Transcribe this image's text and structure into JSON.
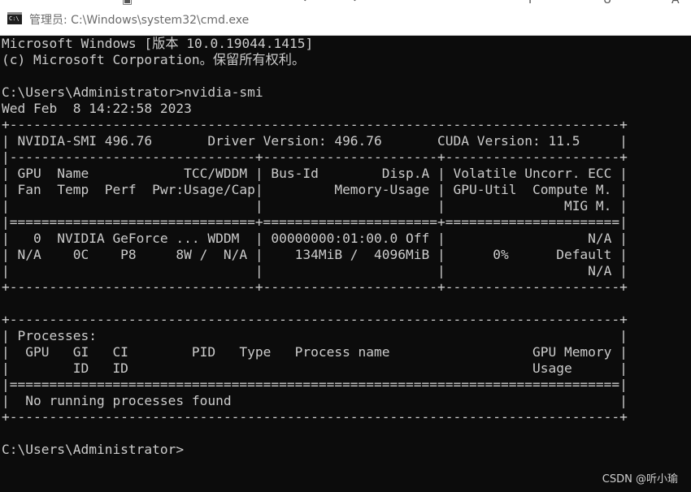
{
  "window": {
    "title": "管理员: C:\\Windows\\system32\\cmd.exe",
    "icon": "cmd-icon"
  },
  "console": {
    "lines": [
      "Microsoft Windows [版本 10.0.19044.1415]",
      "(c) Microsoft Corporation。保留所有权利。",
      "",
      "C:\\Users\\Administrator>nvidia-smi",
      "Wed Feb  8 14:22:58 2023",
      "+-----------------------------------------------------------------------------+",
      "| NVIDIA-SMI 496.76       Driver Version: 496.76       CUDA Version: 11.5     |",
      "|-------------------------------+----------------------+----------------------+",
      "| GPU  Name            TCC/WDDM | Bus-Id        Disp.A | Volatile Uncorr. ECC |",
      "| Fan  Temp  Perf  Pwr:Usage/Cap|         Memory-Usage | GPU-Util  Compute M. |",
      "|                               |                      |               MIG M. |",
      "|===============================+======================+======================|",
      "|   0  NVIDIA GeForce ... WDDM  | 00000000:01:00.0 Off |                  N/A |",
      "| N/A    0C    P8     8W /  N/A |    134MiB /  4096MiB |      0%      Default |",
      "|                               |                      |                  N/A |",
      "+-------------------------------+----------------------+----------------------+",
      "",
      "+-----------------------------------------------------------------------------+",
      "| Processes:                                                                  |",
      "|  GPU   GI   CI        PID   Type   Process name                  GPU Memory |",
      "|        ID   ID                                                   Usage      |",
      "|=============================================================================|",
      "|  No running processes found                                                 |",
      "+-----------------------------------------------------------------------------+",
      "",
      "C:\\Users\\Administrator>"
    ]
  },
  "watermark": "CSDN @听小瑜",
  "colors": {
    "console_bg": "#0c0c0c",
    "console_fg": "#cccccc",
    "titlebar_bg": "#ffffff"
  }
}
